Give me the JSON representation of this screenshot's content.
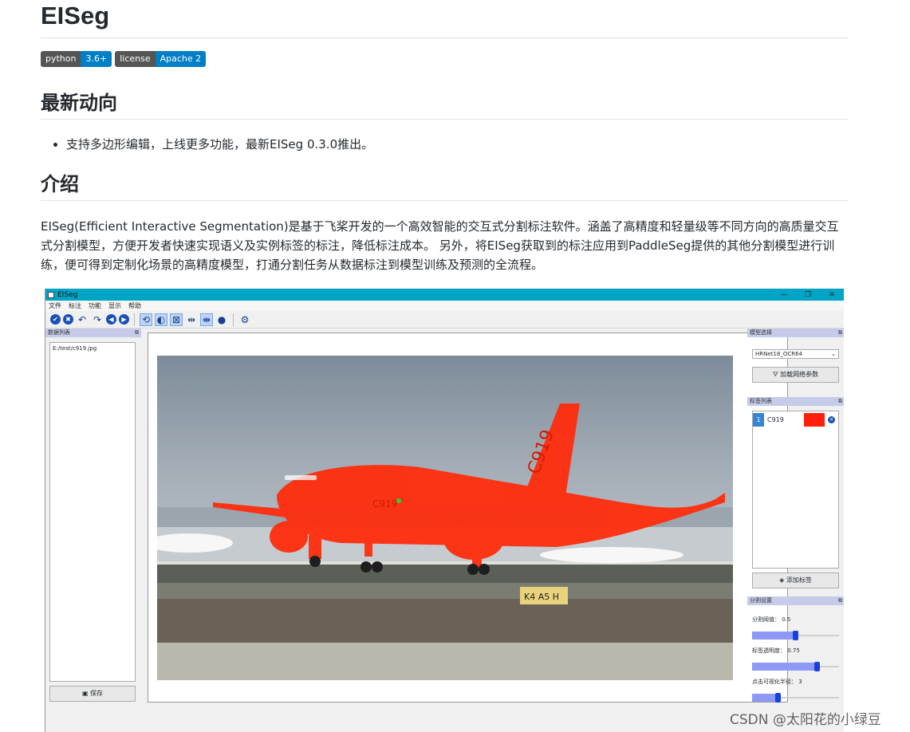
{
  "doc": {
    "title": "EISeg",
    "badges": [
      {
        "left": "python",
        "right": "3.6+"
      },
      {
        "left": "license",
        "right": "Apache 2"
      }
    ],
    "news_heading": "最新动向",
    "news_items": [
      "支持多边形编辑，上线更多功能，最新EISeg 0.3.0推出。"
    ],
    "intro_heading": "介绍",
    "intro_text": "EISeg(Efficient Interactive Segmentation)是基于飞桨开发的一个高效智能的交互式分割标注软件。涵盖了高精度和轻量级等不同方向的高质量交互式分割模型，方便开发者快速实现语义及实例标签的标注，降低标注成本。 另外，将EISeg获取到的标注应用到PaddleSeg提供的其他分割模型进行训练，便可得到定制化场景的高精度模型，打通分割任务从数据标注到模型训练及预测的全流程。"
  },
  "app": {
    "window_title": "EISeg",
    "window_controls": [
      "—",
      "❐",
      "✕"
    ],
    "menu": [
      "文件",
      "标注",
      "功能",
      "显示",
      "帮助"
    ],
    "left_dock_title": "数据列表",
    "files": [
      "E:/test/c919.jpg"
    ],
    "save_label": "保存",
    "model_dock_title": "模型选择",
    "model_value": "HRNet18_OCR64",
    "load_params_label": "加载网络参数",
    "labels_dock_title": "标签列表",
    "labels": [
      {
        "index": "1",
        "name": "C919",
        "color": "#ff1e0a"
      }
    ],
    "add_label": "添加标签",
    "settings_dock_title": "分割设置",
    "threshold_label": "分割阈值： 0.5",
    "threshold_value": 0.5,
    "opacity_label": "标签透明度： 0.75",
    "opacity_value": 0.75,
    "radius_label": "点击可视化半径： 3",
    "radius_value": 0.3,
    "photo_text": {
      "tail": "C919",
      "fuselage": "C919",
      "sign": "K4 A5 H"
    }
  },
  "watermark": "CSDN @太阳花的小绿豆"
}
